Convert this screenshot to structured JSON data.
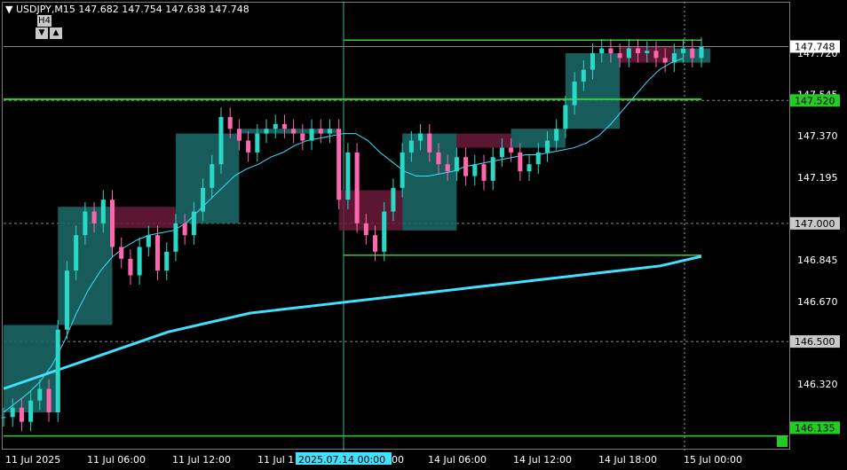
{
  "header": {
    "symbol": "USDJPY,M15",
    "ohlc": "147.682 147.754 147.638 147.748",
    "timeframe_label": "H4",
    "down_btn": "▼",
    "up_btn": "▲"
  },
  "chart_data": {
    "type": "candlestick",
    "symbol": "USDJPY",
    "timeframe": "M15",
    "ylim": [
      146.05,
      147.93
    ],
    "price_ticks": [
      "147.720",
      "147.545",
      "147.370",
      "147.195",
      "146.845",
      "146.670",
      "146.320"
    ],
    "price_labels": {
      "current": "147.748",
      "level_520": "147.520",
      "level_000": "147.000",
      "level_500": "146.500",
      "level_135": "146.135"
    },
    "time_labels": [
      "11 Jul 2025",
      "11 Jul 06:00",
      "11 Jul 12:00",
      "11 Jul 1",
      "14 Jul 06:00",
      "14 Jul 12:00",
      "14 Jul 18:00",
      "15 Jul 00:00"
    ],
    "crosshair_time": "2025.07.14 00:00",
    "crosshair_suffix": "00",
    "horizontal_levels": [
      147.775,
      147.525,
      146.865,
      146.1
    ],
    "h4_boxes": [
      {
        "from": 0,
        "to": 6,
        "open": 146.2,
        "close": 146.57,
        "dir": "up"
      },
      {
        "from": 6,
        "to": 12,
        "open": 146.57,
        "close": 147.07,
        "dir": "up"
      },
      {
        "from": 12,
        "to": 19,
        "open": 147.07,
        "close": 146.98,
        "dir": "down"
      },
      {
        "from": 19,
        "to": 26,
        "open": 147.0,
        "close": 147.38,
        "dir": "up"
      },
      {
        "from": 26,
        "to": 37,
        "open": 147.38,
        "close": 147.4,
        "dir": "up"
      },
      {
        "from": 37,
        "to": 44,
        "open": 147.14,
        "close": 146.97,
        "dir": "down"
      },
      {
        "from": 44,
        "to": 50,
        "open": 146.97,
        "close": 147.38,
        "dir": "up"
      },
      {
        "from": 50,
        "to": 56,
        "open": 147.38,
        "close": 147.32,
        "dir": "down"
      },
      {
        "from": 56,
        "to": 62,
        "open": 147.32,
        "close": 147.4,
        "dir": "up"
      },
      {
        "from": 62,
        "to": 68,
        "open": 147.4,
        "close": 147.72,
        "dir": "up"
      },
      {
        "from": 68,
        "to": 74,
        "open": 147.75,
        "close": 147.68,
        "dir": "down"
      },
      {
        "from": 74,
        "to": 78,
        "open": 147.68,
        "close": 147.74,
        "dir": "up"
      }
    ],
    "close_series": [
      146.18,
      146.22,
      146.16,
      146.25,
      146.3,
      146.2,
      146.55,
      146.8,
      146.95,
      147.05,
      147.0,
      147.1,
      146.9,
      146.85,
      146.78,
      146.9,
      146.95,
      146.8,
      146.88,
      147.0,
      146.95,
      147.05,
      147.15,
      147.25,
      147.45,
      147.4,
      147.35,
      147.3,
      147.38,
      147.4,
      147.42,
      147.4,
      147.38,
      147.35,
      147.4,
      147.38,
      147.4,
      147.1,
      147.3,
      147.0,
      146.95,
      146.88,
      147.05,
      147.15,
      147.3,
      147.35,
      147.38,
      147.3,
      147.25,
      147.22,
      147.28,
      147.2,
      147.25,
      147.18,
      147.28,
      147.32,
      147.3,
      147.22,
      147.25,
      147.3,
      147.35,
      147.4,
      147.5,
      147.6,
      147.65,
      147.72,
      147.74,
      147.72,
      147.7,
      147.74,
      147.72,
      147.73,
      147.7,
      147.68,
      147.72,
      147.74,
      147.7,
      147.748
    ],
    "ma_fast": [
      146.2,
      146.24,
      146.28,
      146.33,
      146.4,
      146.5,
      146.62,
      146.72,
      146.8,
      146.86,
      146.9,
      146.93,
      146.95,
      146.96,
      146.97,
      147.0,
      147.05,
      147.1,
      147.15,
      147.2,
      147.23,
      147.25,
      147.28,
      147.3,
      147.33,
      147.35,
      147.36,
      147.37,
      147.38,
      147.38,
      147.35,
      147.3,
      147.26,
      147.22,
      147.2,
      147.2,
      147.21,
      147.22,
      147.24,
      147.25,
      147.26,
      147.27,
      147.28,
      147.29,
      147.29,
      147.3,
      147.31,
      147.32,
      147.34,
      147.37,
      147.42,
      147.48,
      147.54,
      147.6,
      147.65,
      147.68,
      147.7
    ],
    "ma_slow": [
      146.3,
      146.33,
      146.36,
      146.39,
      146.42,
      146.45,
      146.48,
      146.51,
      146.54,
      146.56,
      146.58,
      146.6,
      146.62,
      146.63,
      146.64,
      146.65,
      146.66,
      146.67,
      146.68,
      146.69,
      146.7,
      146.71,
      146.72,
      146.73,
      146.74,
      146.75,
      146.76,
      146.77,
      146.78,
      146.79,
      146.8,
      146.81,
      146.82,
      146.84,
      146.86
    ]
  }
}
